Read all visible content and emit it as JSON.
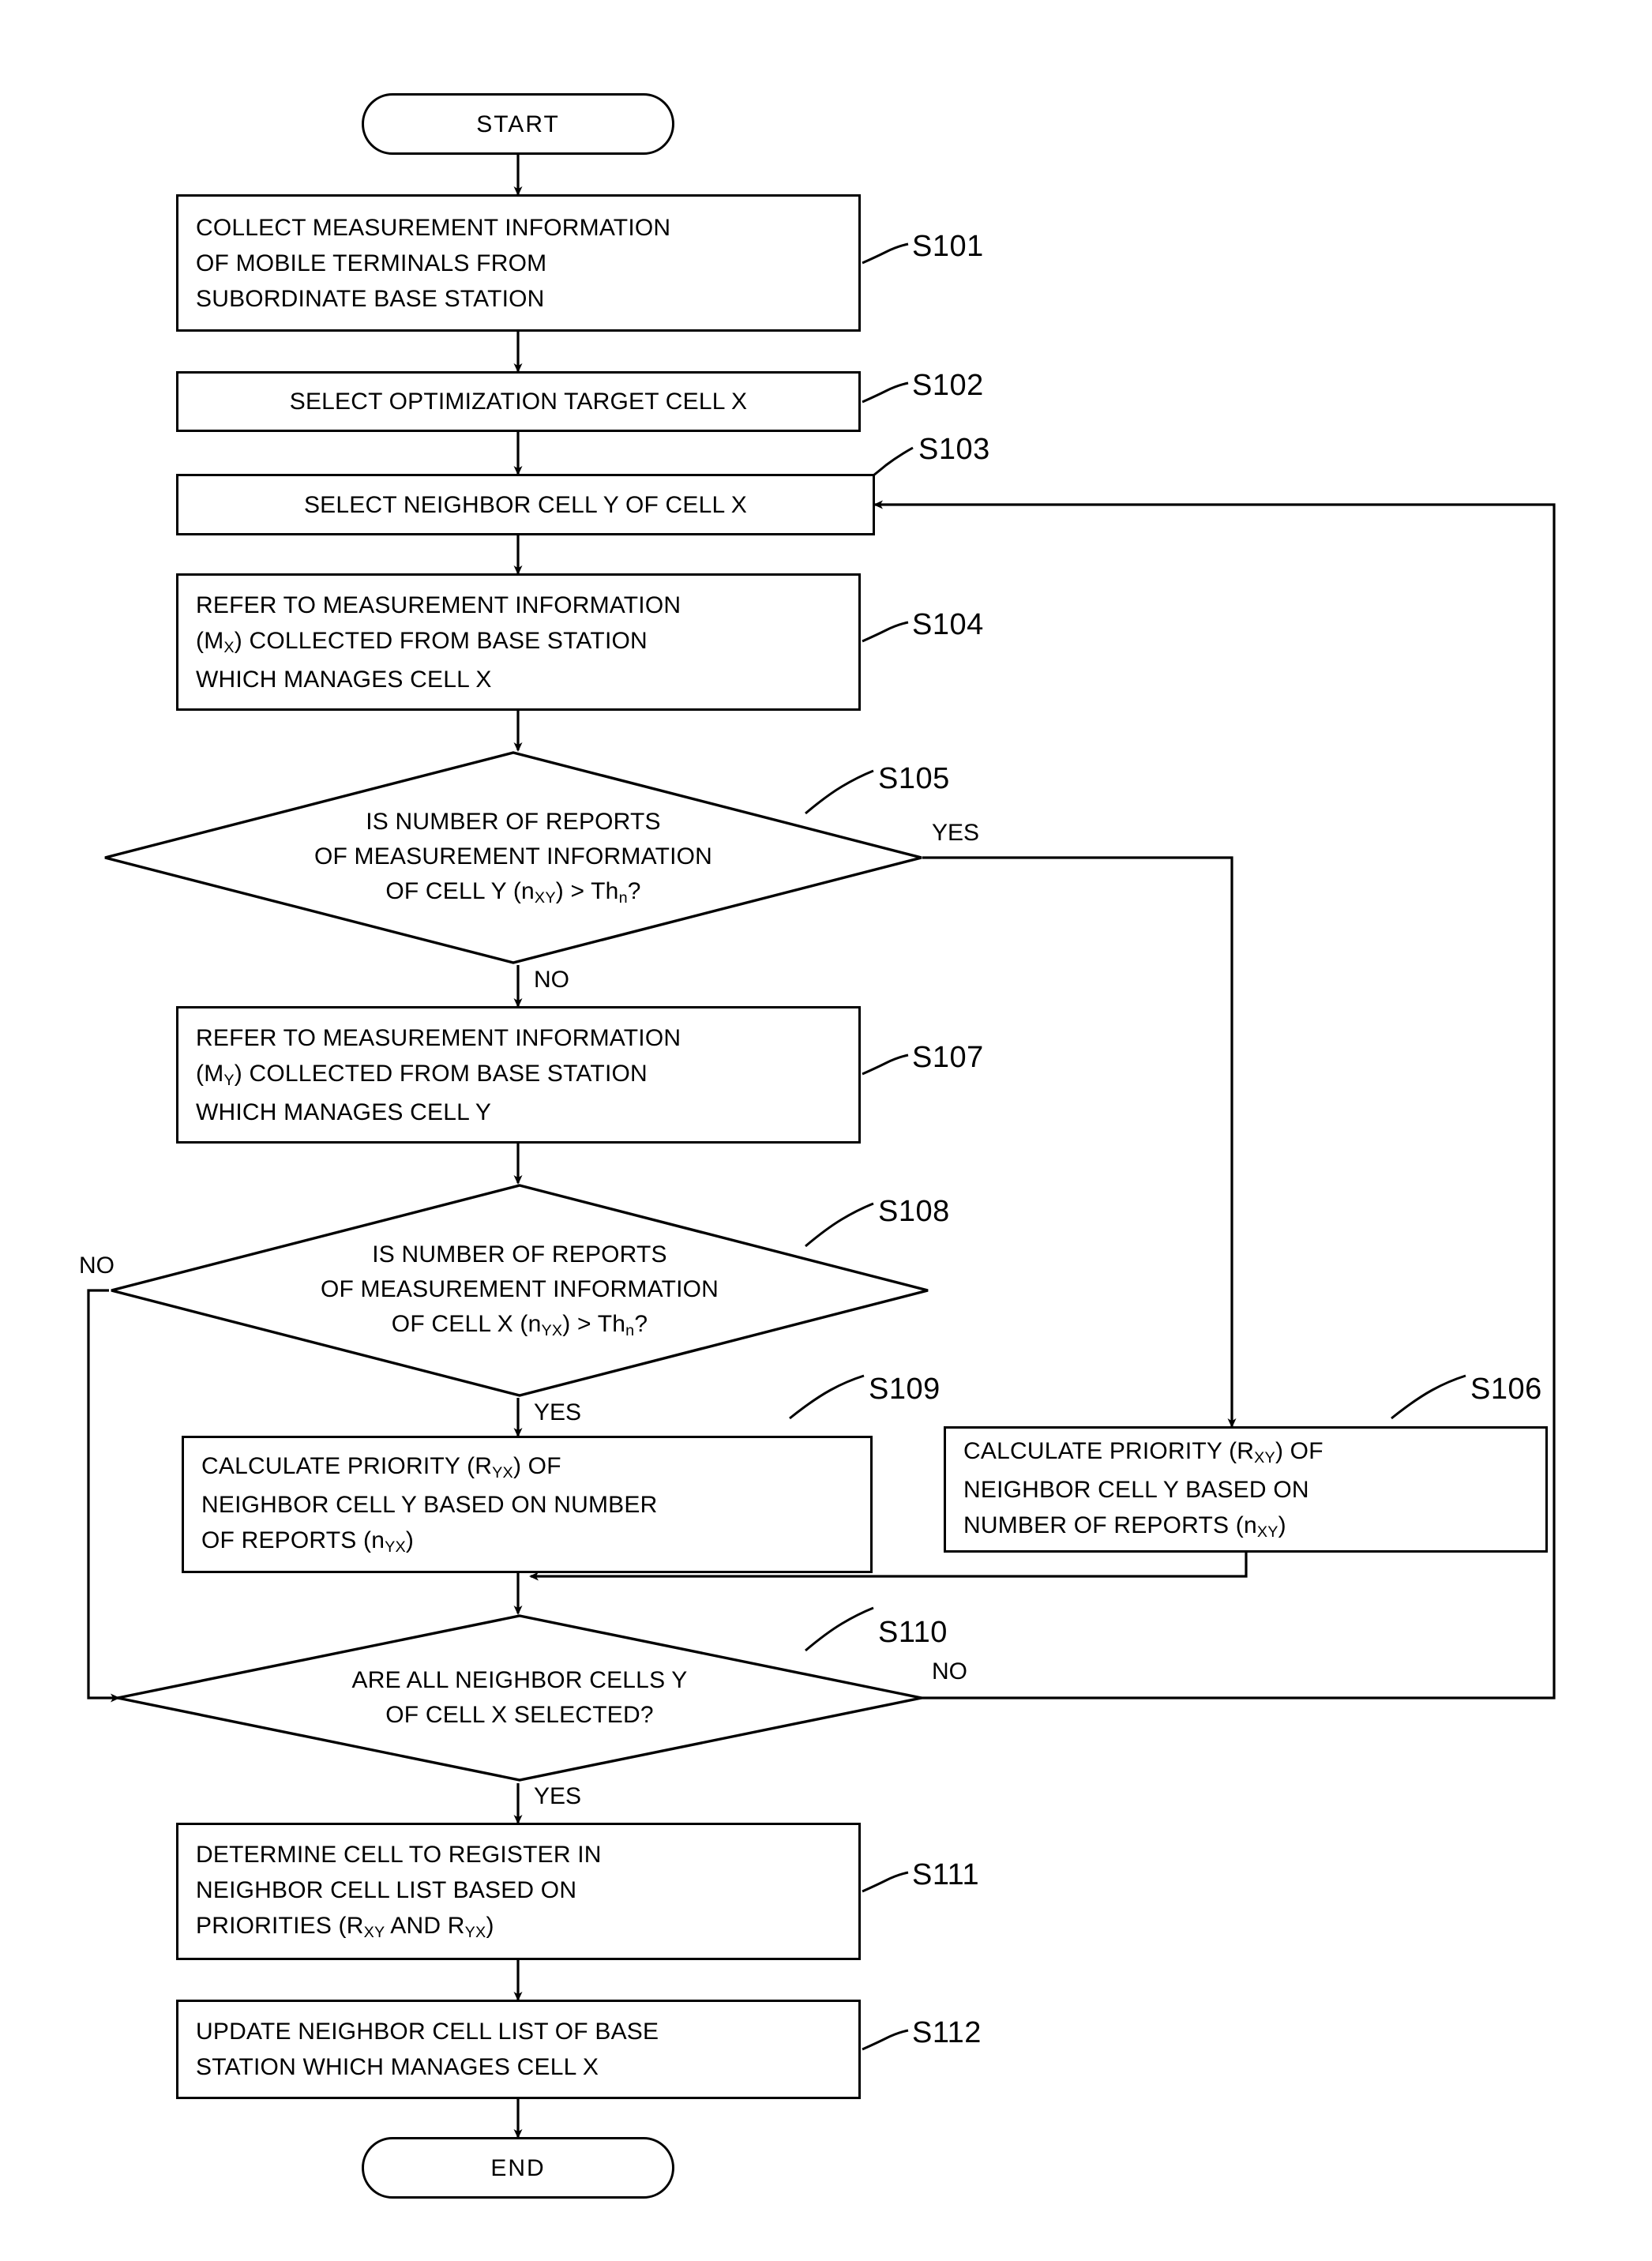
{
  "figure": {
    "type": "flowchart",
    "orientation": "vertical",
    "start_label": "START",
    "end_label": "END"
  },
  "nodes": {
    "start": {
      "label": "START"
    },
    "s101": {
      "step": "S101",
      "lines": [
        "COLLECT MEASUREMENT INFORMATION",
        "OF MOBILE TERMINALS FROM",
        "SUBORDINATE BASE STATION"
      ]
    },
    "s102": {
      "step": "S102",
      "lines": [
        "SELECT OPTIMIZATION TARGET CELL X"
      ]
    },
    "s103": {
      "step": "S103",
      "lines": [
        "SELECT NEIGHBOR CELL Y OF CELL X"
      ]
    },
    "s104": {
      "step": "S104",
      "lines_html": [
        "REFER TO MEASUREMENT INFORMATION",
        "(M<sub>X</sub>) COLLECTED FROM BASE STATION",
        "WHICH MANAGES CELL X"
      ]
    },
    "s105": {
      "step": "S105",
      "lines_html": [
        "IS NUMBER OF REPORTS",
        "OF MEASUREMENT INFORMATION",
        "OF CELL Y (n<sub>XY</sub>) &gt; Th<sub>n</sub>?"
      ],
      "yes_label": "YES",
      "no_label": "NO"
    },
    "s106": {
      "step": "S106",
      "lines_html": [
        "CALCULATE PRIORITY (R<sub>XY</sub>) OF",
        "NEIGHBOR CELL Y BASED ON",
        "NUMBER OF REPORTS (n<sub>XY</sub>)"
      ]
    },
    "s107": {
      "step": "S107",
      "lines_html": [
        "REFER TO MEASUREMENT INFORMATION",
        "(M<sub>Y</sub>) COLLECTED FROM BASE STATION",
        "WHICH MANAGES CELL Y"
      ]
    },
    "s108": {
      "step": "S108",
      "lines_html": [
        "IS NUMBER OF REPORTS",
        "OF MEASUREMENT INFORMATION",
        "OF CELL X (n<sub>YX</sub>) &gt; Th<sub>n</sub>?"
      ],
      "yes_label": "YES",
      "no_label": "NO"
    },
    "s109": {
      "step": "S109",
      "lines_html": [
        "CALCULATE PRIORITY (R<sub>YX</sub>) OF",
        "NEIGHBOR CELL Y BASED ON NUMBER",
        "OF REPORTS (n<sub>YX</sub>)"
      ]
    },
    "s110": {
      "step": "S110",
      "lines_html": [
        "ARE ALL NEIGHBOR CELLS Y",
        "OF CELL X SELECTED?"
      ],
      "yes_label": "YES",
      "no_label": "NO"
    },
    "s111": {
      "step": "S111",
      "lines_html": [
        "DETERMINE CELL TO REGISTER IN",
        "NEIGHBOR CELL LIST BASED ON",
        "PRIORITIES (R<sub>XY</sub> AND R<sub>YX</sub>)"
      ]
    },
    "s112": {
      "step": "S112",
      "lines_html": [
        "UPDATE NEIGHBOR CELL LIST OF BASE",
        "STATION WHICH MANAGES CELL X"
      ]
    },
    "end": {
      "label": "END"
    }
  },
  "colors": {
    "ink": "#000000",
    "paper": "#ffffff"
  }
}
